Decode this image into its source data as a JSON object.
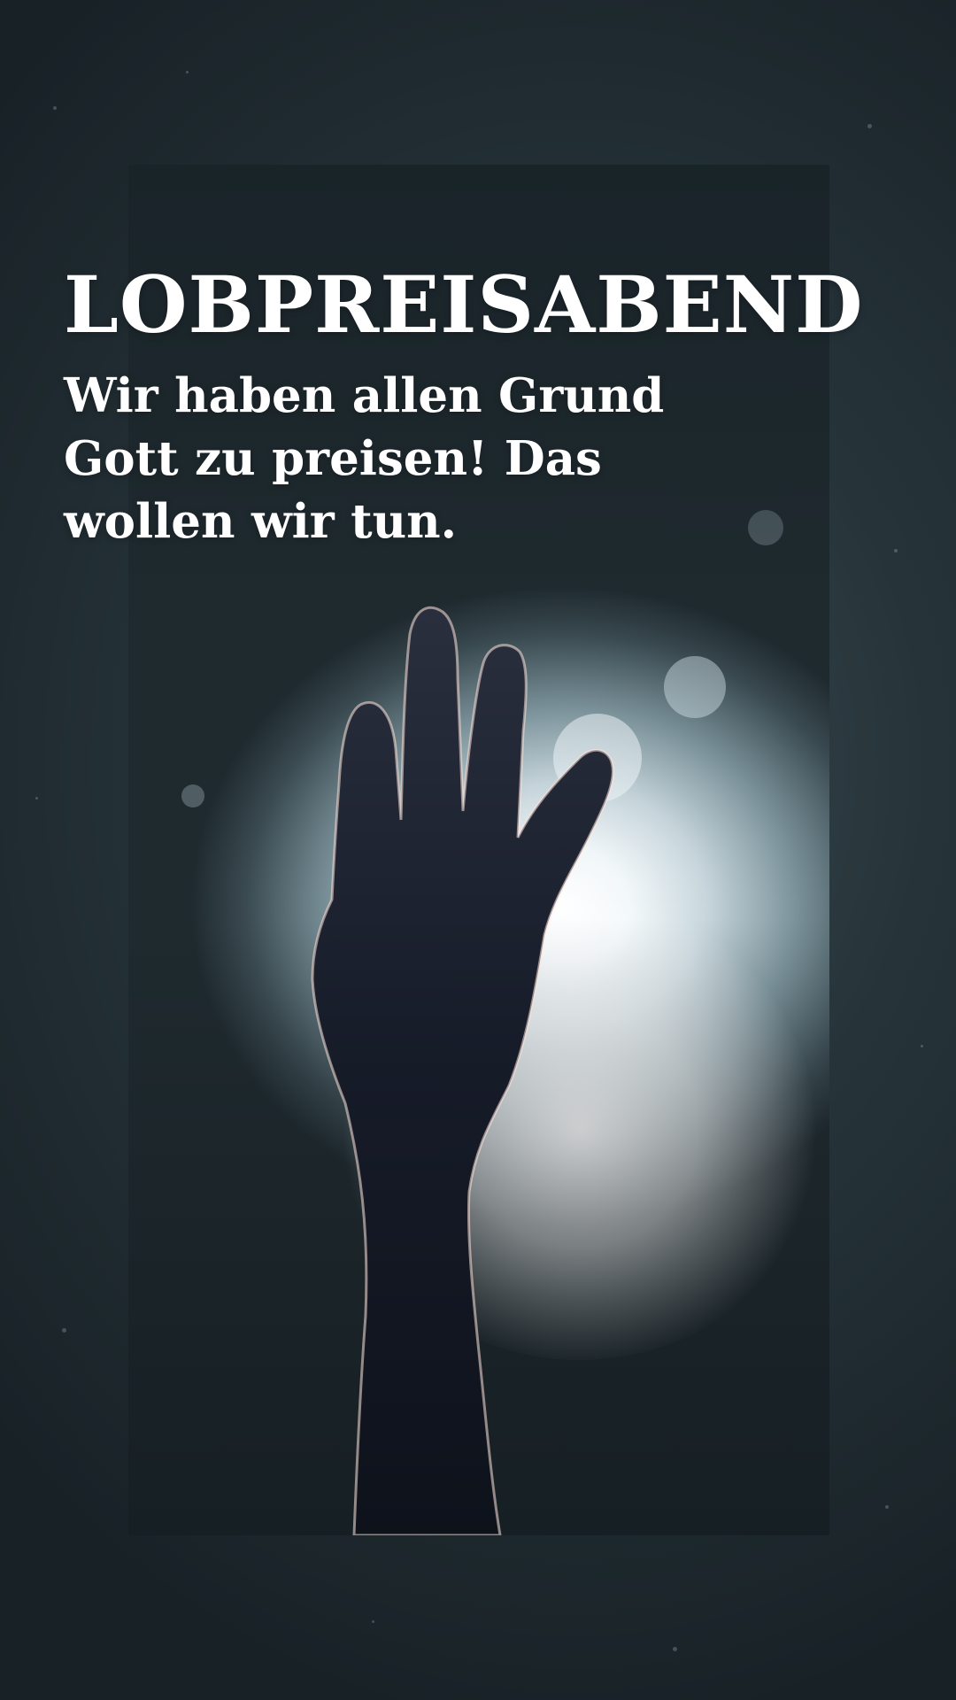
{
  "poster": {
    "title": "LOBPREISABEND",
    "subtitle_lines": [
      "Wir haben allen Grund",
      "Gott zu preisen! Das",
      "wollen wir tun."
    ]
  },
  "colors": {
    "background": "#1c2529",
    "text": "#ffffff",
    "light": "#ffffff"
  },
  "image": {
    "subject": "raised-hand-silhouette-backlit"
  }
}
